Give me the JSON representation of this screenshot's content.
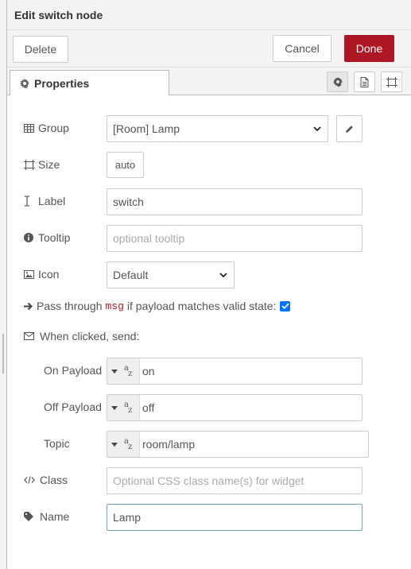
{
  "header": {
    "title": "Edit switch node"
  },
  "toolbar": {
    "delete_label": "Delete",
    "cancel_label": "Cancel",
    "done_label": "Done"
  },
  "tabs": [
    {
      "label": "Properties",
      "icon": "gear-icon"
    }
  ],
  "tab_buttons": [
    "gear-icon",
    "document-icon",
    "frame-icon"
  ],
  "form": {
    "group": {
      "label": "Group",
      "value": "[Room] Lamp"
    },
    "size": {
      "label": "Size",
      "value": "auto"
    },
    "label": {
      "label": "Label",
      "value": "switch"
    },
    "tooltip": {
      "label": "Tooltip",
      "placeholder": "optional tooltip"
    },
    "icon": {
      "label": "Icon",
      "value": "Default"
    },
    "pass": {
      "prefix": "Pass through",
      "code": "msg",
      "suffix": "if payload matches valid state:",
      "checked": true
    },
    "when_clicked": {
      "label": "When clicked, send:"
    },
    "on_payload": {
      "label": "On Payload",
      "value": "on"
    },
    "off_payload": {
      "label": "Off Payload",
      "value": "off"
    },
    "topic": {
      "label": "Topic",
      "value": "room/lamp"
    },
    "class": {
      "label": "Class",
      "placeholder": "Optional CSS class name(s) for widget"
    },
    "name": {
      "label": "Name",
      "value": "Lamp"
    }
  },
  "colors": {
    "accent": "#ad1625",
    "checkbox": "#0075ff",
    "focus": "#6ea3bf"
  }
}
